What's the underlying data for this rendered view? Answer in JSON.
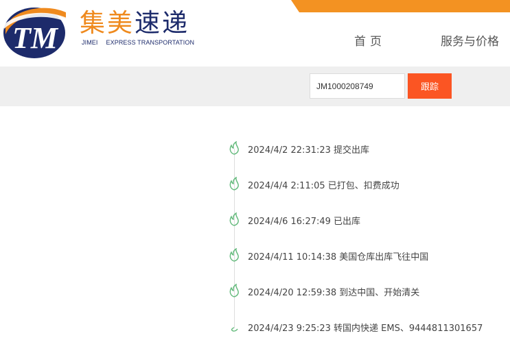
{
  "brand": {
    "logo_letters": "TM",
    "name_cn_part1": "集美",
    "name_cn_part2": "速递",
    "name_en_part1": "JIMEI",
    "name_en_part2": "EXPRESS TRANSPORTATION"
  },
  "nav": {
    "home_label": "首页",
    "price_label": "服务与价格"
  },
  "search": {
    "tracking_number": "JM1000208749",
    "button_label": "跟踪"
  },
  "timeline": {
    "events": [
      {
        "text": "2024/4/2 22:31:23 提交出库"
      },
      {
        "text": "2024/4/4 2:11:05 已打包、扣费成功"
      },
      {
        "text": "2024/4/6 16:27:49 已出库"
      },
      {
        "text": "2024/4/11 10:14:38 美国仓库出库飞往中国"
      },
      {
        "text": "2024/4/20 12:59:38 到达中国、开始清关"
      },
      {
        "text": "2024/4/23 9:25:23 转国内快递 EMS、9444811301657"
      }
    ]
  },
  "colors": {
    "brand_orange": "#ef8a1e",
    "brand_navy": "#1d2b6b",
    "button_orange": "#fb5523",
    "icon_green": "#5fb878"
  }
}
